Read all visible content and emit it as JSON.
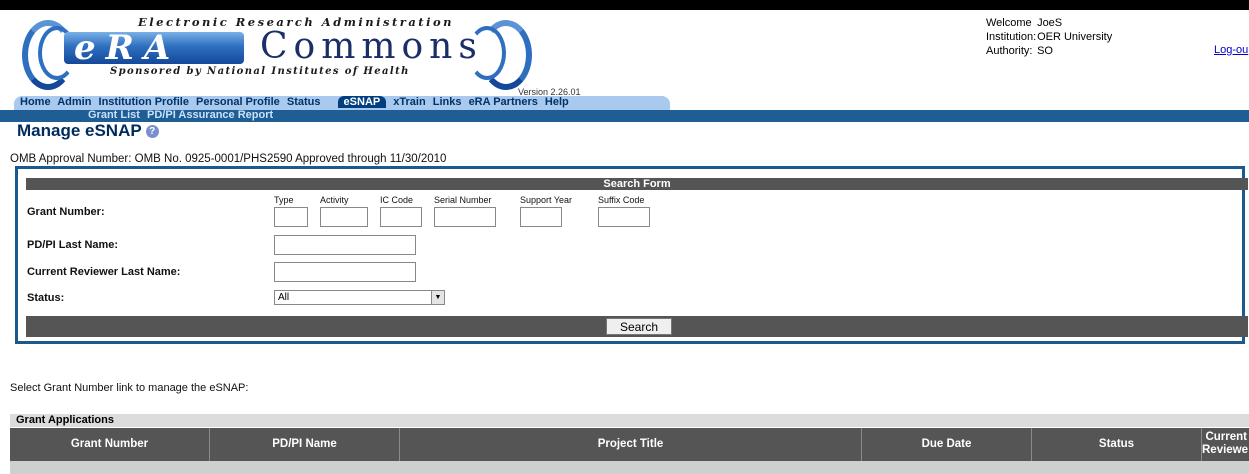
{
  "logo": {
    "tagline": "Electronic Research Administration",
    "era": "eRA",
    "commons": "Commons",
    "sponsor": "Sponsored by National Institutes of Health"
  },
  "version": "Version 2.26.01",
  "user": {
    "welcome_label": "Welcome",
    "welcome_value": "JoeS",
    "institution_label": "Institution:",
    "institution_value": "OER University",
    "authority_label": "Authority:",
    "authority_value": "SO",
    "logout": "Log-ou"
  },
  "nav": {
    "items_before": [
      "Home",
      "Admin",
      "Institution Profile",
      "Personal Profile",
      "Status"
    ],
    "active": "eSNAP",
    "items_after": [
      "xTrain",
      "Links",
      "eRA Partners",
      "Help"
    ]
  },
  "subnav": [
    "Grant List",
    "PD/PI Assurance Report"
  ],
  "page": {
    "title": "Manage eSNAP",
    "help_icon": "question-icon",
    "omb": "OMB Approval Number: OMB No. 0925-0001/PHS2590 Approved through 11/30/2010"
  },
  "search": {
    "header": "Search Form",
    "grant_number_label": "Grant Number:",
    "grant_parts": [
      "Type",
      "Activity",
      "IC Code",
      "Serial Number",
      "Support Year",
      "Suffix Code"
    ],
    "pi_label": "PD/PI Last Name:",
    "reviewer_label": "Current Reviewer Last Name:",
    "status_label": "Status:",
    "status_value": "All",
    "button": "Search"
  },
  "results": {
    "hint": "Select Grant Number link to manage the eSNAP:",
    "section_label": "Grant Applications",
    "columns": [
      "Grant Number",
      "PD/PI Name",
      "Project Title",
      "Due Date",
      "Status"
    ],
    "last_column": [
      "Current",
      "Reviewe"
    ]
  }
}
